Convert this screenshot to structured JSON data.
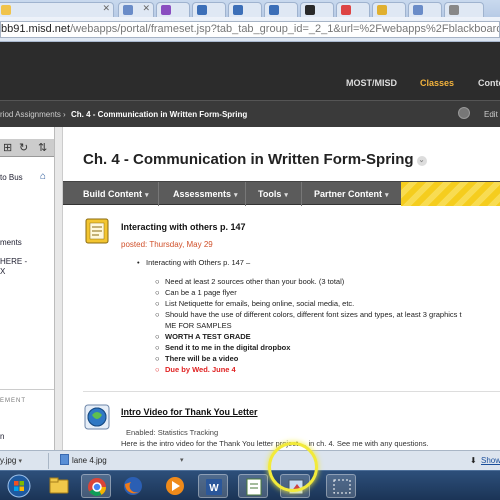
{
  "browser": {
    "url_domain": "bb91.misd.net",
    "url_rest": "/webapps/portal/frameset.jsp?tab_tab_group_id=_2_1&url=%2Fwebapps%2Fblackboard%2Fexecu"
  },
  "bb_header": {
    "tabs": [
      {
        "label": "MOST/MISD",
        "active": false
      },
      {
        "label": "Classes",
        "active": true
      },
      {
        "label": "Conte",
        "active": false
      }
    ]
  },
  "breadcrumb": {
    "parent": "riod Assignments",
    "separator": "›",
    "current": "Ch. 4 - Communication in Written Form-Spring",
    "edit_label": "Edit"
  },
  "left_menu": {
    "items": [
      "to Bus",
      "ments",
      "HERE -",
      "X"
    ],
    "section_header": "EMENT",
    "last_item": "n"
  },
  "content": {
    "title": "Ch. 4 - Communication in Written Form-Spring",
    "actions": [
      {
        "label": "Build Content"
      },
      {
        "label": "Assessments"
      },
      {
        "label": "Tools"
      },
      {
        "label": "Partner Content"
      }
    ],
    "items": [
      {
        "title": "Interacting with others p. 147",
        "posted": "posted: Thursday, May 29",
        "bullet": "Interacting with Others p. 147 –",
        "subs": [
          {
            "text": "Need at least 2 sources other than your book. (3 total)",
            "style": "normal"
          },
          {
            "text": "Can be a 1 page flyer",
            "style": "normal"
          },
          {
            "text": "List Netiquette for emails, being online, social media, etc.",
            "style": "normal"
          },
          {
            "text": "Should have the use of different colors, different font sizes and types, at least 3 graphics t",
            "style": "normal"
          },
          {
            "text": "ME FOR SAMPLES",
            "style": "normal"
          },
          {
            "text": "WORTH A TEST GRADE",
            "style": "bold"
          },
          {
            "text": "Send it to me in the digital dropbox",
            "style": "bold"
          },
          {
            "text": "There will be a video",
            "style": "bold"
          },
          {
            "text": "Due by Wed. June 4",
            "style": "red"
          }
        ]
      },
      {
        "title": "Intro Video for Thank You Letter",
        "enabled": "Enabled:  Statistics Tracking",
        "desc": "Here is the intro video for the Thank You letter project.... in ch. 4.  See me with any questions."
      }
    ]
  },
  "downloads": [
    {
      "name": "y.jpg"
    },
    {
      "name": "lane 4.jpg"
    }
  ],
  "downloads_show": "Show",
  "taskbar_icons": [
    "windows-start-icon",
    "explorer-icon",
    "chrome-icon",
    "firefox-icon",
    "media-icon",
    "word-icon",
    "notebook-icon",
    "paint-icon",
    "snip-icon"
  ]
}
